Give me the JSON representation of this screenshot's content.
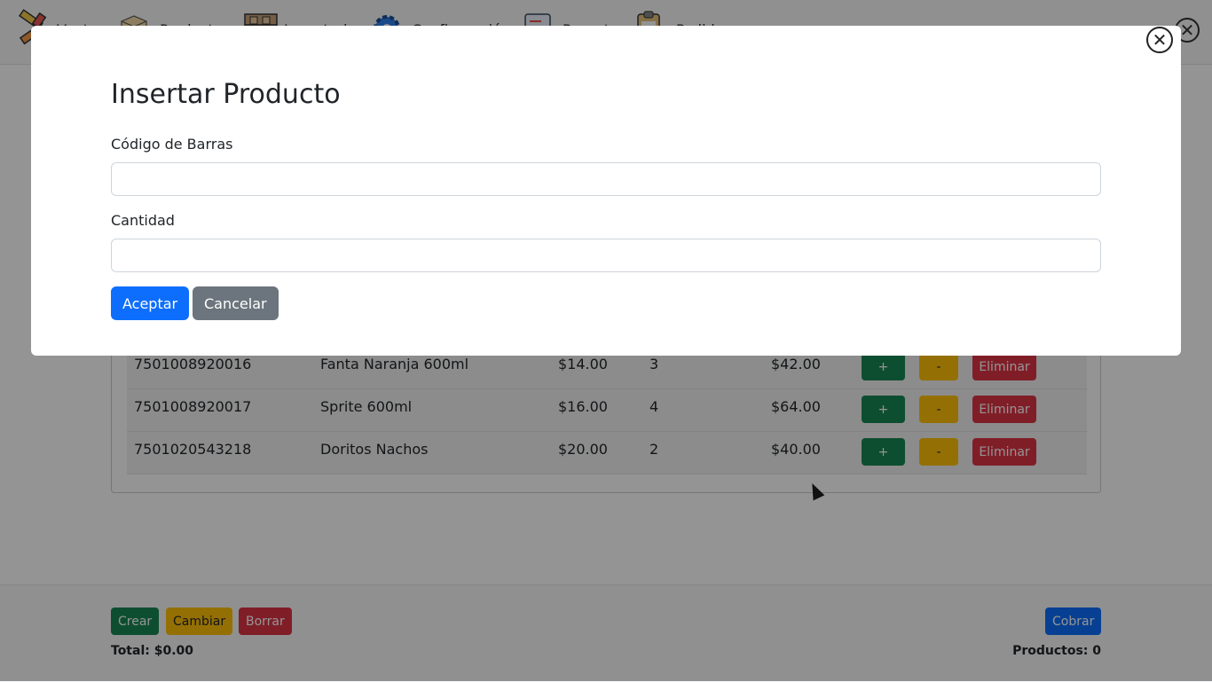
{
  "nav": {
    "items": [
      {
        "icon": "ruler-tags-icon",
        "label": "Venta"
      },
      {
        "icon": "box-icon",
        "label": "Productos"
      },
      {
        "icon": "warehouse-shelves-icon",
        "label": "Inventario"
      },
      {
        "icon": "gear-icon",
        "label": "Configuración"
      },
      {
        "icon": "document-icon",
        "label": "Reportes"
      },
      {
        "icon": "clipboard-icon",
        "label": "Pedidos"
      }
    ],
    "close_symbol": "✕"
  },
  "table": {
    "rows": [
      {
        "code": "7501008920016",
        "name": "Fanta Naranja 600ml",
        "price": "$14.00",
        "qty": "3",
        "subtotal": "$42.00"
      },
      {
        "code": "7501008920017",
        "name": "Sprite 600ml",
        "price": "$16.00",
        "qty": "4",
        "subtotal": "$64.00"
      },
      {
        "code": "7501020543218",
        "name": "Doritos Nachos",
        "price": "$20.00",
        "qty": "2",
        "subtotal": "$40.00"
      }
    ],
    "row_actions": {
      "plus": "+",
      "minus": "-",
      "delete": "Eliminar"
    }
  },
  "footer": {
    "create": "Crear",
    "change": "Cambiar",
    "delete": "Borrar",
    "charge": "Cobrar",
    "total": "Total: $0.00",
    "products": "Productos: 0"
  },
  "modal": {
    "title": "Insertar Producto",
    "barcode_label": "Código de Barras",
    "barcode_value": "",
    "quantity_label": "Cantidad",
    "quantity_value": "",
    "accept": "Aceptar",
    "cancel": "Cancelar",
    "close_symbol": "✕"
  },
  "colors": {
    "primary": "#0d6efd",
    "secondary": "#6c757d",
    "success": "#198754",
    "warning": "#ffc107",
    "danger": "#dc3545"
  }
}
